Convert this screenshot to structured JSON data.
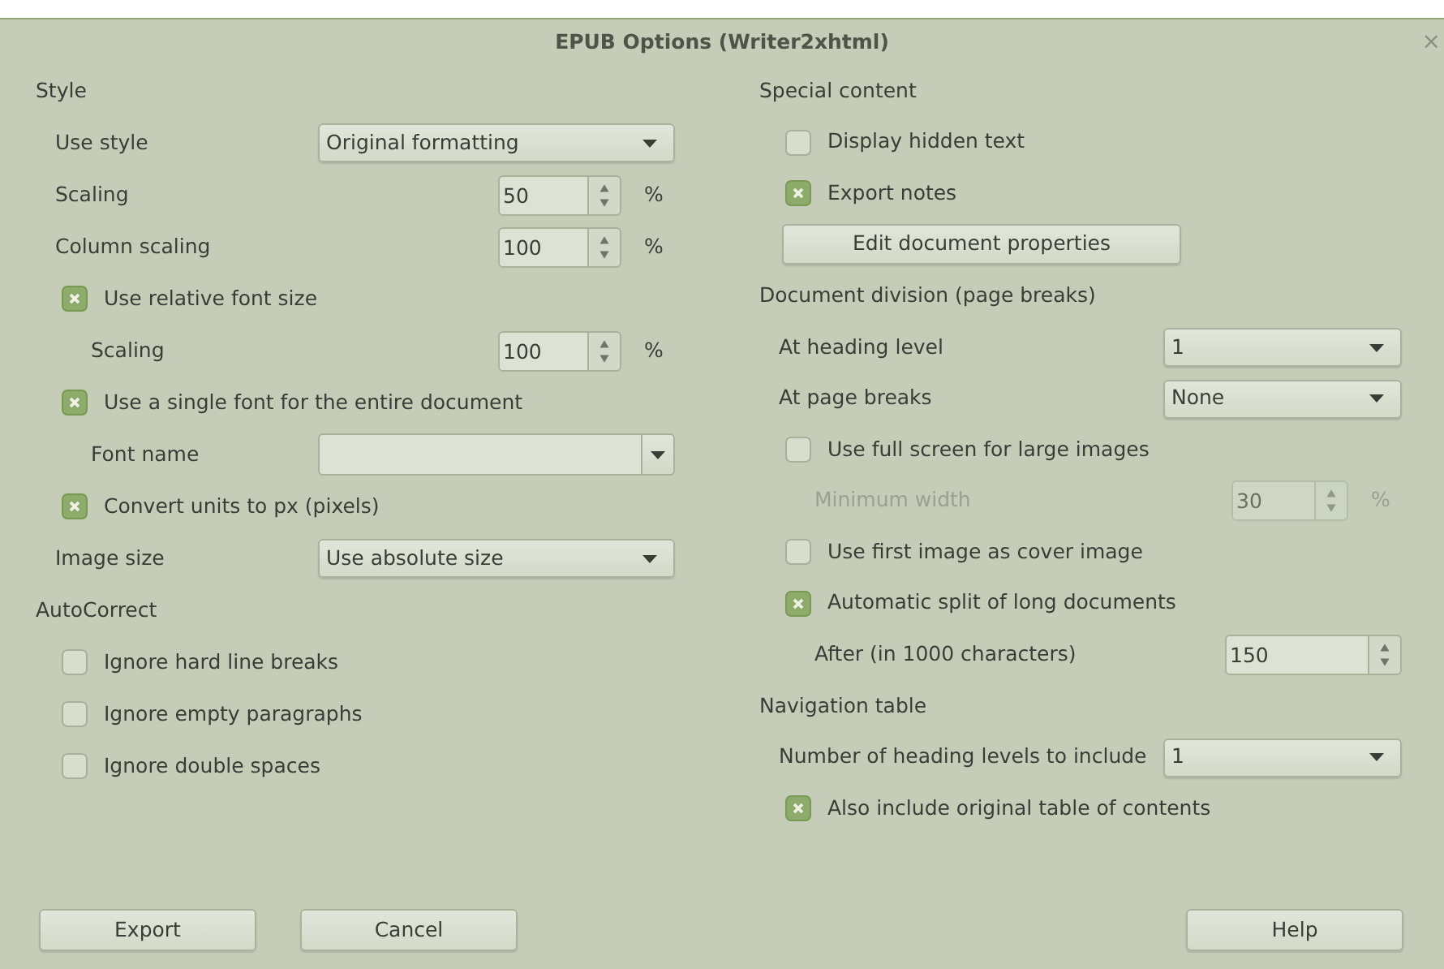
{
  "window": {
    "title": "EPUB Options (Writer2xhtml)",
    "close": "×"
  },
  "columns": [
    {
      "sections": [
        {
          "heading": "Style",
          "items": [
            {
              "kind": "dropdown",
              "label": "Use style",
              "value": "Original formatting"
            },
            {
              "kind": "spin",
              "label": "Scaling",
              "value": "50",
              "unit": "%",
              "disabled": false
            },
            {
              "kind": "spin",
              "label": "Column scaling",
              "value": "100",
              "unit": "%",
              "disabled": false
            },
            {
              "kind": "check",
              "label": "Use relative font size",
              "checked": true,
              "children": [
                {
                  "kind": "spin",
                  "label": "Scaling",
                  "value": "100",
                  "unit": "%",
                  "disabled": false
                }
              ]
            },
            {
              "kind": "check",
              "label": "Use a single font for the entire document",
              "checked": true,
              "children": [
                {
                  "kind": "combo",
                  "label": "Font name"
                }
              ]
            },
            {
              "kind": "check",
              "label": "Convert units to px (pixels)",
              "checked": true
            },
            {
              "kind": "dropdown",
              "label": "Image size",
              "value": "Use absolute size"
            }
          ]
        },
        {
          "heading": "AutoCorrect",
          "items": [
            {
              "kind": "check",
              "label": "Ignore hard line breaks",
              "checked": false
            },
            {
              "kind": "check",
              "label": "Ignore empty paragraphs",
              "checked": false
            },
            {
              "kind": "check",
              "label": "Ignore double spaces",
              "checked": false
            }
          ]
        }
      ]
    },
    {
      "sections": [
        {
          "heading": "Special content",
          "items": [
            {
              "kind": "check",
              "label": "Display hidden text",
              "checked": false
            },
            {
              "kind": "check",
              "label": "Export notes",
              "checked": true
            },
            {
              "kind": "button",
              "label": "Edit document properties"
            }
          ]
        },
        {
          "heading": "Document division (page breaks)",
          "items": [
            {
              "kind": "dropdown",
              "label": "At heading level",
              "value": "1"
            },
            {
              "kind": "dropdown",
              "label": "At page breaks",
              "value": "None"
            },
            {
              "kind": "check",
              "label": "Use full screen for large images",
              "checked": false,
              "children": [
                {
                  "kind": "spin",
                  "label": "Minimum width",
                  "value": "30",
                  "unit": "%",
                  "disabled": true
                }
              ]
            },
            {
              "kind": "check",
              "label": "Use first image as cover image",
              "checked": false
            },
            {
              "kind": "check",
              "label": "Automatic split of long documents",
              "checked": true,
              "children": [
                {
                  "kind": "spin",
                  "label": "After (in 1000 characters)",
                  "value": "150",
                  "disabled": false
                }
              ]
            }
          ]
        },
        {
          "heading": "Navigation table",
          "items": [
            {
              "kind": "dropdown",
              "label": "Number of heading levels to include",
              "value": "1"
            },
            {
              "kind": "check",
              "label": "Also include original table of contents",
              "checked": true
            }
          ]
        }
      ]
    }
  ],
  "buttons": {
    "left": [
      "Export",
      "Cancel"
    ],
    "right": [
      "Help"
    ]
  }
}
